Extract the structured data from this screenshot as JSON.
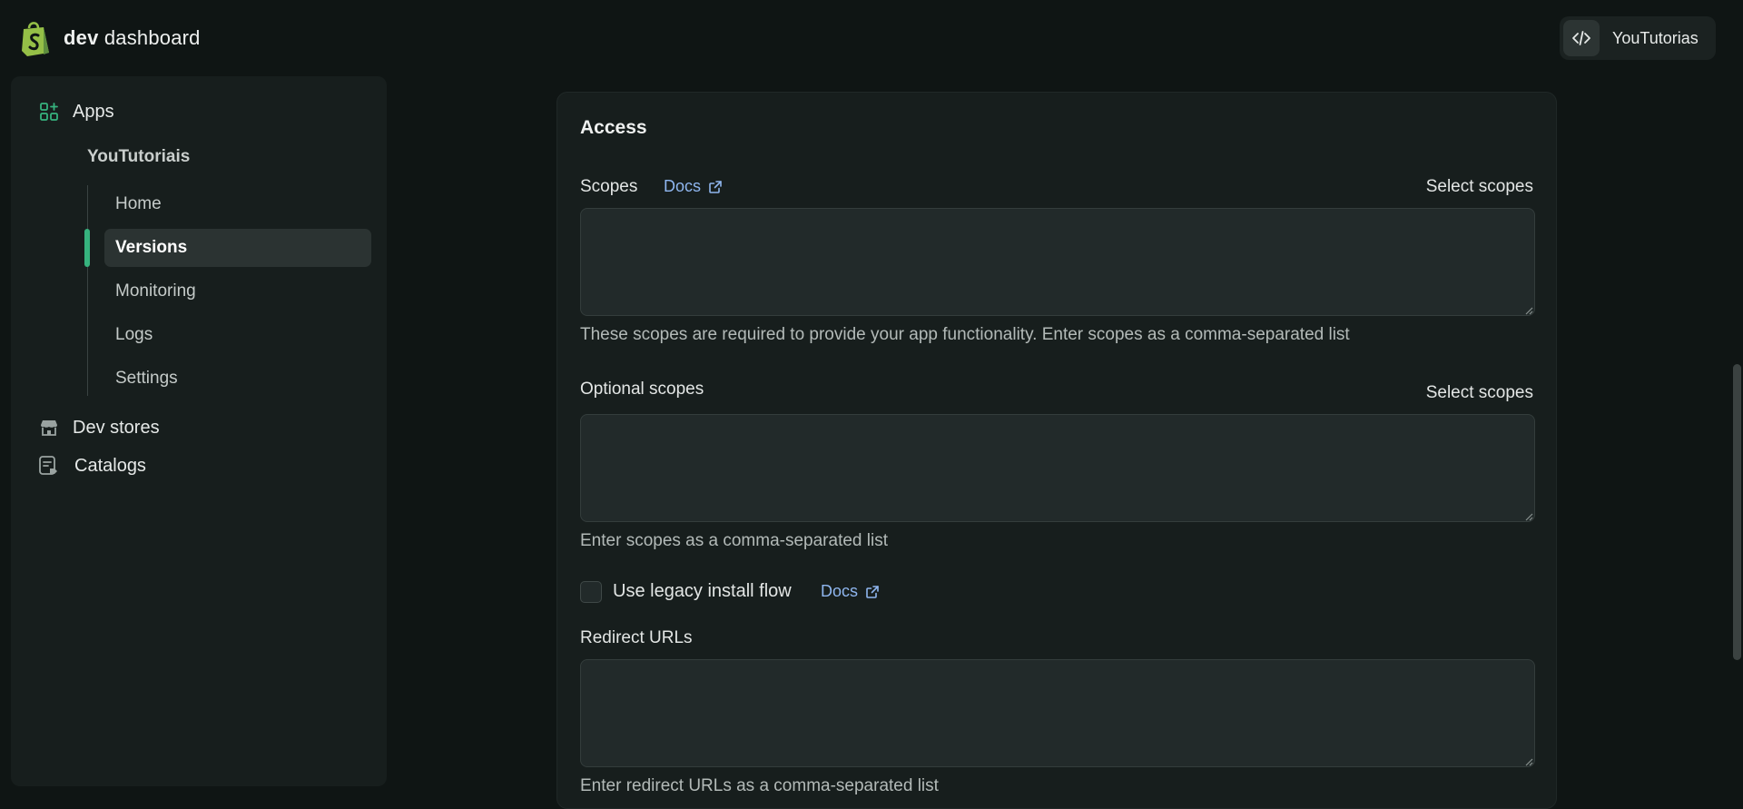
{
  "header": {
    "brand_bold": "dev",
    "brand_rest": "dashboard",
    "account_name": "YouTutorias",
    "brand_color": "#95bf47"
  },
  "sidebar": {
    "apps_label": "Apps",
    "app_name": "YouTutoriais",
    "sub_items": [
      "Home",
      "Versions",
      "Monitoring",
      "Logs",
      "Settings"
    ],
    "active_item": "Versions",
    "dev_stores_label": "Dev stores",
    "catalogs_label": "Catalogs",
    "accent_color": "#36b37e"
  },
  "access": {
    "title": "Access",
    "scopes_label": "Scopes",
    "scopes_docs": "Docs",
    "scopes_select": "Select scopes",
    "scopes_value": "",
    "scopes_help": "These scopes are required to provide your app functionality. Enter scopes as a comma-separated list",
    "optional_label": "Optional scopes",
    "optional_select": "Select scopes",
    "optional_value": "",
    "optional_help": "Enter scopes as a comma-separated list",
    "legacy_label": "Use legacy install flow",
    "legacy_checked": false,
    "legacy_docs": "Docs",
    "redirect_label": "Redirect URLs",
    "redirect_value": "",
    "redirect_help": "Enter redirect URLs as a comma-separated list"
  }
}
